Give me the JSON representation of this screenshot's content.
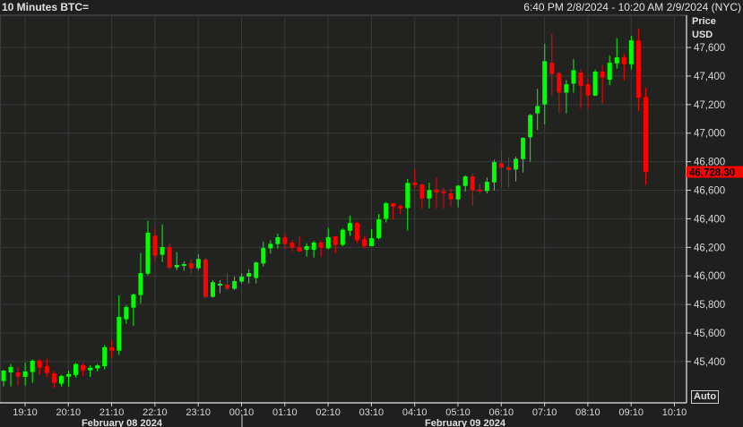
{
  "header": {
    "title": "10 Minutes BTC=",
    "range": "6:40 PM 2/8/2024 - 10:20 AM 2/9/2024 (NYC)"
  },
  "auto_button": "Auto",
  "colors": {
    "up": "#00ff00",
    "down": "#ff0000",
    "grid": "#3a3b39",
    "plot_bg": "#222321"
  },
  "chart_data": {
    "type": "candlestick",
    "title": "10 Minutes BTC=",
    "ylabel": "Price USD",
    "ylabel_lines": [
      "Price",
      "USD"
    ],
    "ylim": [
      45111,
      47826
    ],
    "yticks": [
      45400,
      45600,
      45800,
      46000,
      46200,
      46400,
      46600,
      46800,
      47000,
      47200,
      47400,
      47600
    ],
    "ytick_labels": [
      "45,400",
      "45,600",
      "45,800",
      "46,000",
      "46,200",
      "46,400",
      "46,600",
      "46,800",
      "47,000",
      "47,200",
      "47,400",
      "47,600"
    ],
    "xtick_labels": [
      "19:10",
      "20:10",
      "21:10",
      "22:10",
      "23:10",
      "00:10",
      "01:10",
      "02:10",
      "03:10",
      "04:10",
      "05:10",
      "06:10",
      "07:10",
      "08:10",
      "09:10",
      "10:10"
    ],
    "date_labels": [
      "February 08 2024",
      "February 09 2024"
    ],
    "start_time": "18:40",
    "interval_minutes": 10,
    "last_price": 46728.3,
    "last_price_label": "46,728.30",
    "grid": true,
    "ohlc": [
      [
        45264,
        45341,
        45226,
        45337
      ],
      [
        45324,
        45383,
        45226,
        45362
      ],
      [
        45324,
        45362,
        45233,
        45295
      ],
      [
        45293,
        45393,
        45233,
        45331
      ],
      [
        45327,
        45414,
        45251,
        45406
      ],
      [
        45406,
        45419,
        45306,
        45358
      ],
      [
        45368,
        45419,
        45293,
        45320
      ],
      [
        45316,
        45331,
        45216,
        45251
      ],
      [
        45245,
        45306,
        45226,
        45299
      ],
      [
        45295,
        45337,
        45226,
        45312
      ],
      [
        45306,
        45389,
        45289,
        45383
      ],
      [
        45375,
        45389,
        45299,
        45339
      ],
      [
        45339,
        45373,
        45293,
        45356
      ],
      [
        45352,
        45383,
        45331,
        45373
      ],
      [
        45368,
        45515,
        45345,
        45500
      ],
      [
        45500,
        45550,
        45429,
        45477
      ],
      [
        45477,
        45864,
        45446,
        45713
      ],
      [
        45696,
        45795,
        45665,
        45782
      ],
      [
        45778,
        45876,
        45651,
        45870
      ],
      [
        45866,
        46160,
        45805,
        46020
      ],
      [
        46016,
        46386,
        46004,
        46303
      ],
      [
        46282,
        46334,
        46108,
        46142
      ],
      [
        46148,
        46359,
        46098,
        46202
      ],
      [
        46202,
        46225,
        46048,
        46058
      ],
      [
        46060,
        46165,
        46041,
        46077
      ],
      [
        46073,
        46102,
        46035,
        46083
      ],
      [
        46089,
        46115,
        46018,
        46054
      ],
      [
        46054,
        46152,
        46041,
        46119
      ],
      [
        46115,
        46125,
        45847,
        45853
      ],
      [
        45853,
        45970,
        45847,
        45956
      ],
      [
        45937,
        45970,
        45878,
        45945
      ],
      [
        45939,
        46020,
        45901,
        45910
      ],
      [
        45910,
        45995,
        45901,
        45964
      ],
      [
        45960,
        46018,
        45947,
        45995
      ],
      [
        45995,
        46046,
        45947,
        46020
      ],
      [
        45985,
        46100,
        45947,
        46094
      ],
      [
        46087,
        46240,
        46066,
        46196
      ],
      [
        46193,
        46250,
        46156,
        46225
      ],
      [
        46223,
        46296,
        46193,
        46271
      ],
      [
        46271,
        46292,
        46187,
        46223
      ],
      [
        46233,
        46250,
        46172,
        46197
      ],
      [
        46202,
        46277,
        46166,
        46172
      ],
      [
        46183,
        46229,
        46135,
        46208
      ],
      [
        46183,
        46244,
        46129,
        46233
      ],
      [
        46233,
        46250,
        46135,
        46197
      ],
      [
        46193,
        46337,
        46187,
        46271
      ],
      [
        46277,
        46281,
        46160,
        46218
      ],
      [
        46218,
        46333,
        46208,
        46323
      ],
      [
        46317,
        46421,
        46281,
        46371
      ],
      [
        46371,
        46379,
        46233,
        46250
      ],
      [
        46256,
        46281,
        46193,
        46208
      ],
      [
        46208,
        46327,
        46208,
        46264
      ],
      [
        46264,
        46434,
        46256,
        46396
      ],
      [
        46400,
        46519,
        46375,
        46509
      ],
      [
        46509,
        46509,
        46396,
        46486
      ],
      [
        46490,
        46500,
        46434,
        46473
      ],
      [
        46475,
        46678,
        46317,
        46651
      ],
      [
        46653,
        46745,
        46615,
        46636
      ],
      [
        46640,
        46647,
        46473,
        46542
      ],
      [
        46542,
        46653,
        46473,
        46601
      ],
      [
        46605,
        46689,
        46473,
        46584
      ],
      [
        46593,
        46615,
        46473,
        46584
      ],
      [
        46578,
        46615,
        46484,
        46536
      ],
      [
        46536,
        46636,
        46480,
        46632
      ],
      [
        46630,
        46705,
        46590,
        46697
      ],
      [
        46697,
        46716,
        46490,
        46599
      ],
      [
        46605,
        46647,
        46574,
        46599
      ],
      [
        46595,
        46689,
        46578,
        46659
      ],
      [
        46655,
        46814,
        46599,
        46797
      ],
      [
        46789,
        46881,
        46620,
        46758
      ],
      [
        46762,
        46831,
        46620,
        46741
      ],
      [
        46745,
        46835,
        46661,
        46820
      ],
      [
        46818,
        46971,
        46724,
        46967
      ],
      [
        46971,
        47134,
        46799,
        47127
      ],
      [
        47138,
        47311,
        47023,
        47190
      ],
      [
        47201,
        47625,
        47061,
        47504
      ],
      [
        47493,
        47696,
        47263,
        47414
      ],
      [
        47420,
        47431,
        47138,
        47284
      ],
      [
        47284,
        47372,
        47138,
        47343
      ],
      [
        47347,
        47518,
        47284,
        47441
      ],
      [
        47424,
        47447,
        47173,
        47332
      ],
      [
        47343,
        47382,
        47173,
        47263
      ],
      [
        47263,
        47445,
        47259,
        47431
      ],
      [
        47431,
        47476,
        47207,
        47389
      ],
      [
        47374,
        47545,
        47336,
        47493
      ],
      [
        47489,
        47665,
        47451,
        47531
      ],
      [
        47531,
        47556,
        47368,
        47483
      ],
      [
        47483,
        47681,
        47445,
        47650
      ],
      [
        47650,
        47734,
        47155,
        47249
      ],
      [
        47253,
        47320,
        46636,
        46728.3
      ]
    ]
  }
}
